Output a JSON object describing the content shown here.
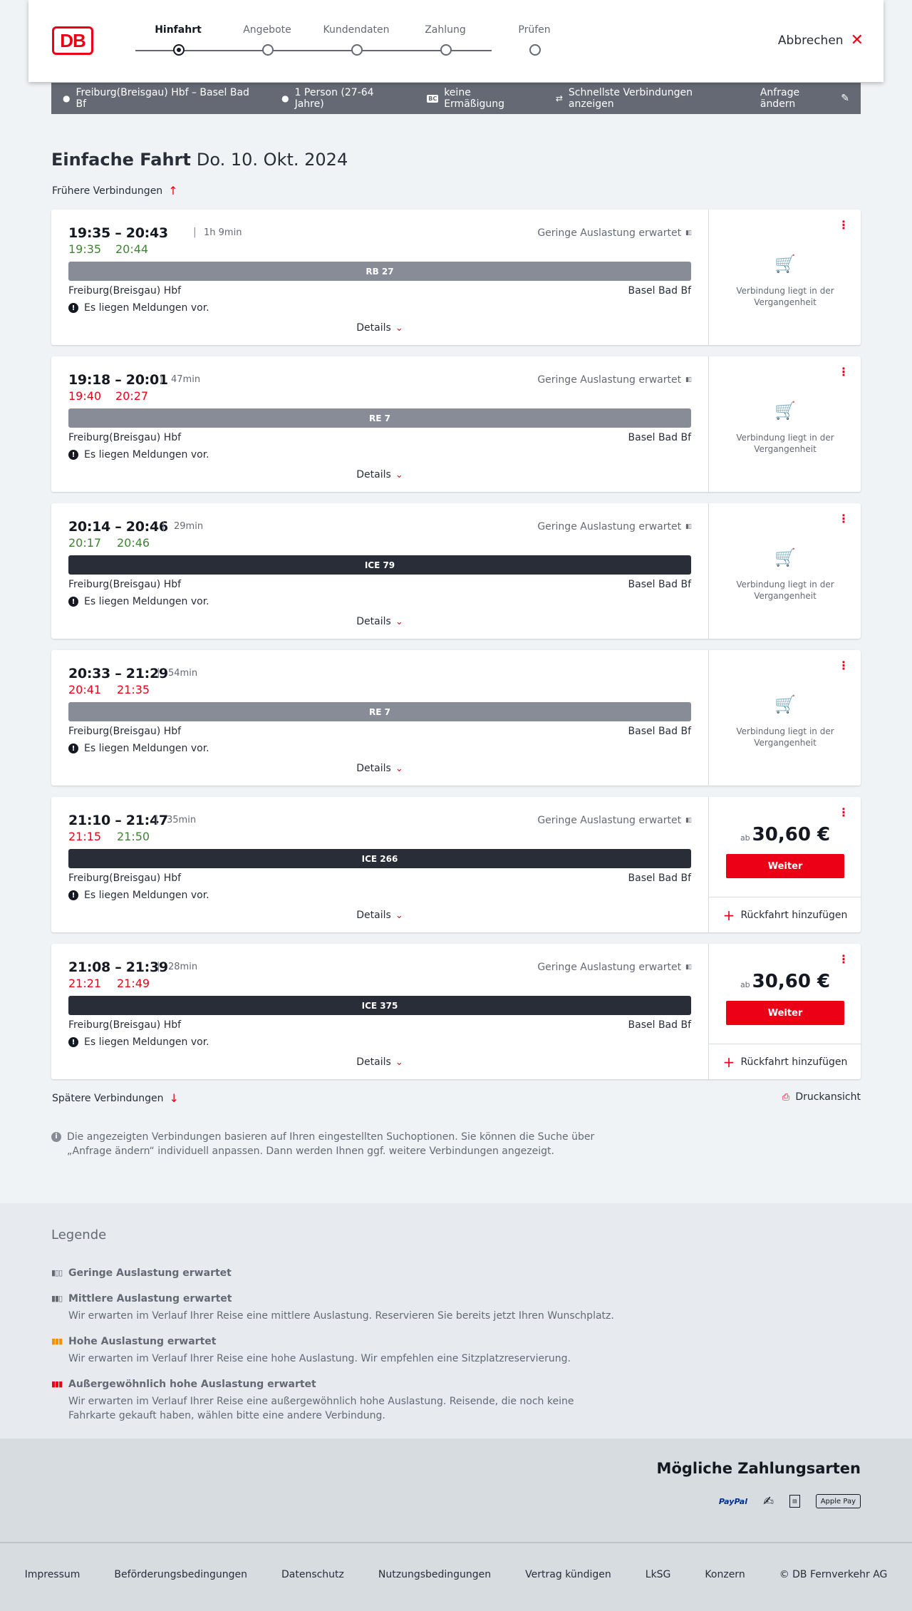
{
  "header": {
    "logo_text": "DB",
    "steps": [
      {
        "label": "Hinfahrt",
        "active": true
      },
      {
        "label": "Angebote",
        "active": false
      },
      {
        "label": "Kundendaten",
        "active": false
      },
      {
        "label": "Zahlung",
        "active": false
      },
      {
        "label": "Prüfen",
        "active": false
      }
    ],
    "cancel_label": "Abbrechen"
  },
  "search": {
    "route": "Freiburg(Breisgau) Hbf – Basel Bad Bf",
    "passengers": "1 Person (27-64 Jahre)",
    "bahncard_badge": "BC",
    "discount": "keine Ermäßigung",
    "fastest": "Schnellste Verbindungen anzeigen",
    "edit": "Anfrage ändern"
  },
  "page": {
    "trip_type": "Einfache Fahrt",
    "date": "Do. 10. Okt. 2024",
    "earlier": "Frühere Verbindungen",
    "later": "Spätere Verbindungen",
    "print": "Druckansicht",
    "info": "Die angezeigten Verbindungen basieren auf Ihren eingestellten Suchoptionen. Sie können die Suche über „Anfrage ändern“ individuell anpassen. Dann werden Ihnen ggf. weitere Verbindungen angezeigt."
  },
  "labels": {
    "details": "Details",
    "messages": "Es liegen Meldungen vor.",
    "past": "Verbindung liegt in der Vergangenheit",
    "price_prefix": "ab",
    "continue": "Weiter",
    "return": "Rückfahrt hinzufügen",
    "separator": "|"
  },
  "connections": [
    {
      "times": "19:35 – 20:43",
      "duration": "1h 9min",
      "rt_dep": "19:35",
      "rt_arr": "20:44",
      "dep_status": "ok",
      "arr_status": "ok",
      "load": "Geringe Auslastung erwartet",
      "train": "RB 27",
      "train_kind": "regio",
      "from": "Freiburg(Breisgau) Hbf",
      "to": "Basel Bad Bf",
      "past": true,
      "price": ""
    },
    {
      "times": "19:18 – 20:01",
      "duration": "47min",
      "rt_dep": "19:40",
      "rt_arr": "20:27",
      "dep_status": "late",
      "arr_status": "late",
      "load": "Geringe Auslastung erwartet",
      "train": "RE 7",
      "train_kind": "regio",
      "from": "Freiburg(Breisgau) Hbf",
      "to": "Basel Bad Bf",
      "past": true,
      "price": ""
    },
    {
      "times": "20:14 – 20:46",
      "duration": "29min",
      "rt_dep": "20:17",
      "rt_arr": "20:46",
      "dep_status": "ok",
      "arr_status": "ok",
      "load": "Geringe Auslastung erwartet",
      "train": "ICE 79",
      "train_kind": "ice",
      "from": "Freiburg(Breisgau) Hbf",
      "to": "Basel Bad Bf",
      "past": true,
      "price": ""
    },
    {
      "times": "20:33 – 21:29",
      "duration": "54min",
      "rt_dep": "20:41",
      "rt_arr": "21:35",
      "dep_status": "late",
      "arr_status": "late",
      "load": "",
      "train": "RE 7",
      "train_kind": "regio",
      "from": "Freiburg(Breisgau) Hbf",
      "to": "Basel Bad Bf",
      "past": true,
      "price": ""
    },
    {
      "times": "21:10 – 21:47",
      "duration": "35min",
      "rt_dep": "21:15",
      "rt_arr": "21:50",
      "dep_status": "late",
      "arr_status": "ok",
      "load": "Geringe Auslastung erwartet",
      "train": "ICE 266",
      "train_kind": "ice",
      "from": "Freiburg(Breisgau) Hbf",
      "to": "Basel Bad Bf",
      "past": false,
      "price": "30,60 €"
    },
    {
      "times": "21:08 – 21:39",
      "duration": "28min",
      "rt_dep": "21:21",
      "rt_arr": "21:49",
      "dep_status": "late",
      "arr_status": "late",
      "load": "Geringe Auslastung erwartet",
      "train": "ICE 375",
      "train_kind": "ice",
      "from": "Freiburg(Breisgau) Hbf",
      "to": "Basel Bad Bf",
      "past": false,
      "price": "30,60 €"
    }
  ],
  "legend": {
    "title": "Legende",
    "items": [
      {
        "title": "Geringe Auslastung erwartet",
        "desc": "",
        "color": "#646973"
      },
      {
        "title": "Mittlere Auslastung erwartet",
        "desc": "Wir erwarten im Verlauf Ihrer Reise eine mittlere Auslastung. Reservieren Sie bereits jetzt Ihren Wunschplatz.",
        "color": "#646973"
      },
      {
        "title": "Hohe Auslastung erwartet",
        "desc": "Wir erwarten im Verlauf Ihrer Reise eine hohe Auslastung. Wir empfehlen eine Sitzplatzreservierung.",
        "color": "#f39200"
      },
      {
        "title": "Außergewöhnlich hohe Auslastung erwartet",
        "desc": "Wir erwarten im Verlauf Ihrer Reise eine außergewöhnlich hohe Auslastung. Reisende, die noch keine Fahrkarte gekauft haben, wählen bitte eine andere Verbindung.",
        "color": "#ec0016"
      }
    ]
  },
  "payment": {
    "title": "Mögliche Zahlungsarten",
    "methods": [
      "PayPal",
      "Apple Pay"
    ]
  },
  "footer": {
    "links": [
      "Impressum",
      "Beförderungsbedingungen",
      "Datenschutz",
      "Nutzungsbedingungen",
      "Vertrag kündigen",
      "LkSG",
      "Konzern",
      "© DB Fernverkehr AG"
    ]
  },
  "colors": {
    "accent": "#ec0016",
    "on_time": "#408335",
    "late": "#ec0016",
    "ice_bar": "#282d37",
    "regio_bar": "#878c96"
  }
}
